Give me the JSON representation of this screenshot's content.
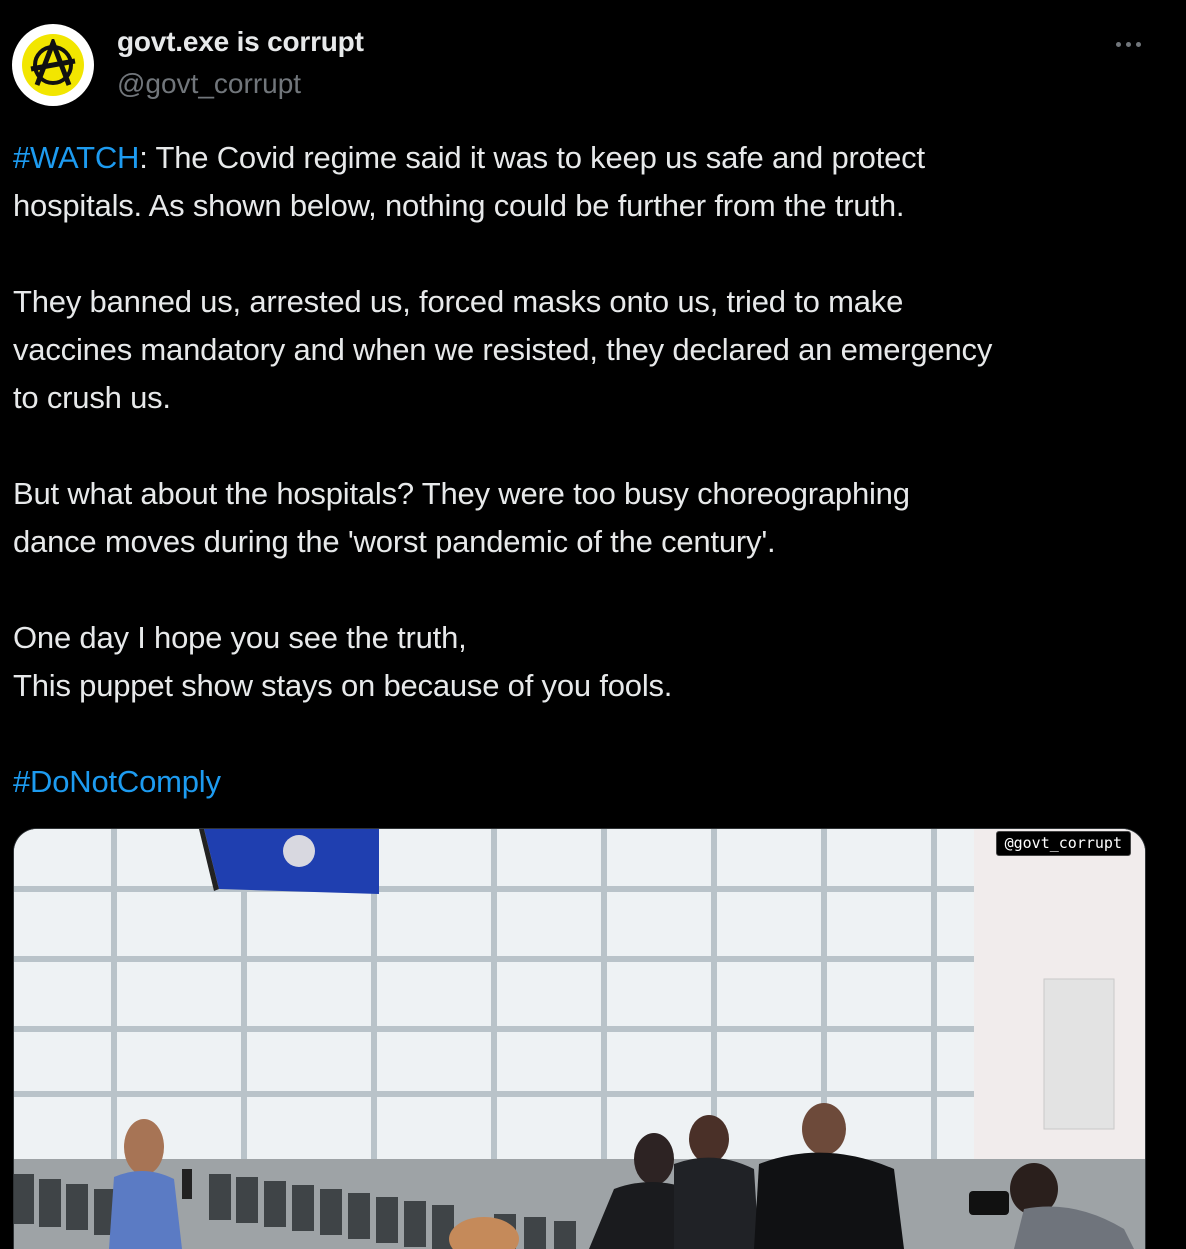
{
  "author": {
    "display_name": "govt.exe is corrupt",
    "handle": "@govt_corrupt"
  },
  "more_icon": "ellipsis-icon",
  "tweet": {
    "p1_hashtag": "#WATCH",
    "p1_line1_rest": ": The Covid regime said it was to keep us safe and protect",
    "p1_line2": "hospitals. As shown below, nothing could be further from the truth.",
    "p2_line1": "They banned us, arrested us, forced masks onto us, tried to make",
    "p2_line2": "vaccines mandatory and when we resisted, they declared an emergency",
    "p2_line3": "to crush us.",
    "p3_line1": "But what about the hospitals? They were too busy choreographing",
    "p3_line2": "dance moves during the 'worst pandemic of the century'.",
    "p4_line1": "One day I hope you see the truth,",
    "p4_line2": "This puppet show stays on because of you fools.",
    "hashtag_final": "#DoNotComply"
  },
  "media": {
    "watermark": "@govt_corrupt"
  },
  "colors": {
    "background": "#000000",
    "text": "#e7e9ea",
    "secondary": "#71767b",
    "link": "#1d9bf0",
    "avatar_yellow": "#f2e600"
  }
}
